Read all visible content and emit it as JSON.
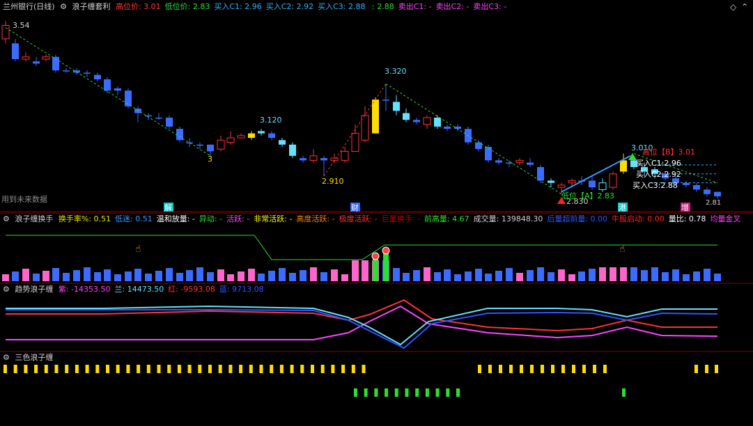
{
  "header": {
    "stock_title": "兰州银行(日线)",
    "indicator_name": "浪子缠套利",
    "items": [
      {
        "label": "高位价:",
        "value": "3.01",
        "color": "#ff3b3b"
      },
      {
        "label": "低位价:",
        "value": "2.83",
        "color": "#29e02f"
      },
      {
        "label": "买入C1:",
        "value": "2.96",
        "color": "#33b2ff"
      },
      {
        "label": "买入C2:",
        "value": "2.92",
        "color": "#33b2ff"
      },
      {
        "label": "买入C3:",
        "value": "2.88",
        "color": "#33b2ff"
      },
      {
        "label": "",
        "value": ": 2.88",
        "color": "#29e02f"
      },
      {
        "label": "卖出C1:",
        "value": "-",
        "color": "#ff44ff"
      },
      {
        "label": "卖出C2:",
        "value": "-",
        "color": "#ff44ff"
      },
      {
        "label": "卖出C3:",
        "value": "-",
        "color": "#ff44ff"
      }
    ]
  },
  "main_chart": {
    "future_data_label": "用到未来数据",
    "annotations": {
      "start_price": "3.54",
      "peak1": "3.120",
      "bottom1": "3",
      "bottom2": "2.910",
      "peak2": "3.320",
      "peak3": "3.010",
      "low_price": "2.830",
      "last_price": "2.81",
      "high_tag": "高位【B】3.01",
      "low_tag": "低位【A】2.83",
      "buy1": "买入C1:2.96",
      "buy2": "买入C2:2.92",
      "buy3": "买入C3:2.88"
    },
    "markers": [
      {
        "text": "解",
        "color": "#0ac8c8"
      },
      {
        "text": "财",
        "color": "#3366ff"
      },
      {
        "text": "港",
        "color": "#0ac8c8"
      },
      {
        "text": "增",
        "color": "#c81e7d"
      }
    ]
  },
  "panel2": {
    "title": "浪子缠换手",
    "items": [
      {
        "label": "换手率%:",
        "value": "0.51",
        "color": "#e6e600"
      },
      {
        "label": "低迷:",
        "value": "0.51",
        "color": "#3399ff"
      },
      {
        "label": "温和放量:",
        "value": "-",
        "color": "#ffffff"
      },
      {
        "label": "异动:",
        "value": "-",
        "color": "#29e02f"
      },
      {
        "label": "活跃:",
        "value": "-",
        "color": "#ff44ff"
      },
      {
        "label": "非常活跃:",
        "value": "-",
        "color": "#ffff00"
      },
      {
        "label": "高度活跃:",
        "value": "-",
        "color": "#ff8800"
      },
      {
        "label": "极度活跃:",
        "value": "-",
        "color": "#ff3333"
      },
      {
        "label": "巨量换手:",
        "value": "-",
        "color": "#bb0000"
      },
      {
        "label": "前高量:",
        "value": "4.67",
        "color": "#29e02f"
      },
      {
        "label": "成交量:",
        "value": "139848.30",
        "color": "#d0d0d0"
      },
      {
        "label": "后量超前量:",
        "value": "0.00",
        "color": "#3355ff"
      },
      {
        "label": "牛股启动:",
        "value": "0.00",
        "color": "#ff2222"
      },
      {
        "label": "量比:",
        "value": "0.78",
        "color": "#ffffff"
      },
      {
        "label": "均量金叉",
        "value": "",
        "color": "#ff44ff"
      }
    ]
  },
  "panel3": {
    "title": "趋势浪子缠",
    "items": [
      {
        "label": "紫:",
        "value": "-14353.50",
        "color": "#ff44ff"
      },
      {
        "label": "兰:",
        "value": "14473.50",
        "color": "#66e0ff"
      },
      {
        "label": "红:",
        "value": "-9593.08",
        "color": "#ff3333"
      },
      {
        "label": "蓝:",
        "value": "9713.08",
        "color": "#3355ff"
      }
    ]
  },
  "panel4": {
    "title": "三色浪子缠"
  },
  "colors": {
    "up": "#ff3333",
    "down": "#3b6cff",
    "bg": "#000000",
    "grid": "#8b0000",
    "title": "#d0d0d0"
  }
}
